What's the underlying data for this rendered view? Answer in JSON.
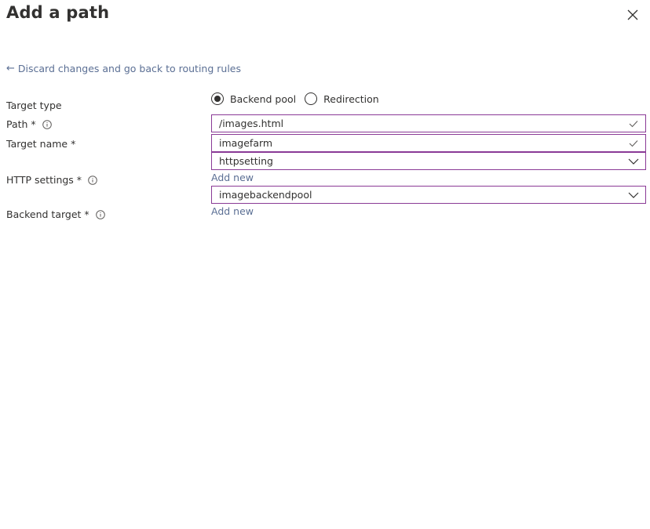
{
  "panel": {
    "title": "Add a path",
    "back_link": "Discard changes and go back to routing rules"
  },
  "labels": {
    "target_type": "Target type",
    "path": "Path *",
    "target_name": "Target name *",
    "http_settings": "HTTP settings *",
    "backend_target": "Backend target *"
  },
  "target_type": {
    "options": [
      "Backend pool",
      "Redirection"
    ],
    "selected": "Backend pool"
  },
  "fields": {
    "path_value": "/images.html",
    "target_name_value": "imagefarm",
    "http_settings_value": "httpsetting",
    "backend_target_value": "imagebackendpool"
  },
  "links": {
    "add_new_http": "Add new",
    "add_new_backend": "Add new"
  },
  "colors": {
    "field_border": "#8a3a96",
    "link": "#5b6f94",
    "text": "#323130"
  }
}
